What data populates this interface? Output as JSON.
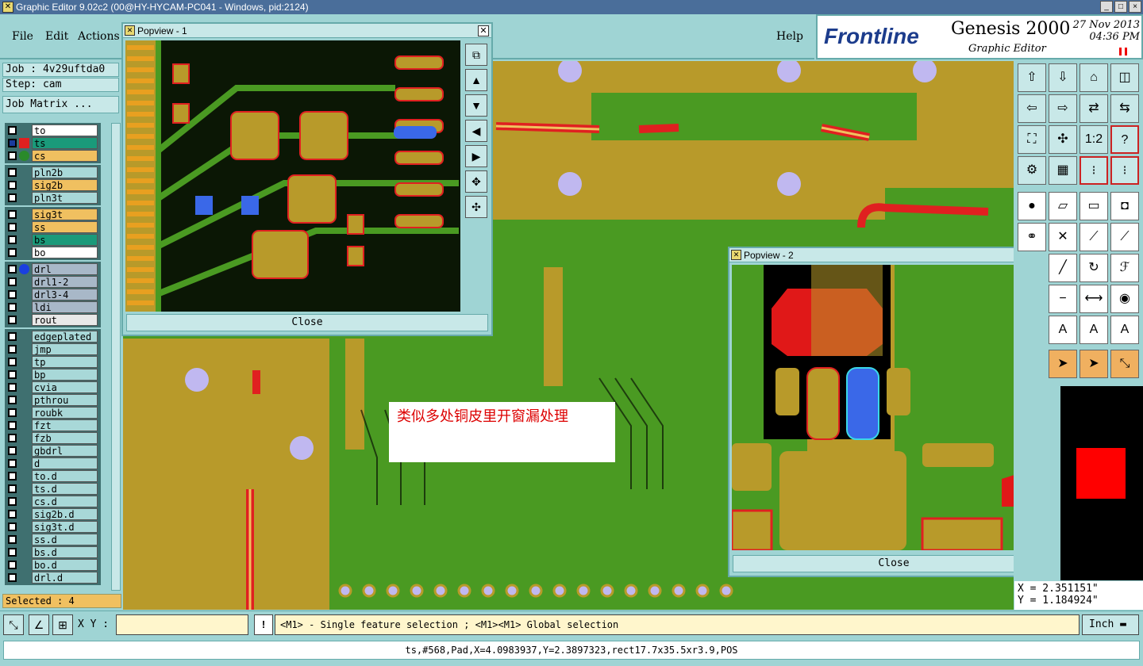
{
  "window": {
    "title": "Graphic Editor 9.02c2 (00@HY-HYCAM-PC041 - Windows, pid:2124)",
    "buttons": [
      "_",
      "□",
      "×"
    ]
  },
  "menu": {
    "file": "File",
    "edit": "Edit",
    "actions": "Actions",
    "help": "Help"
  },
  "logo": {
    "brand": "Frontline",
    "product": "Genesis 2000",
    "subtitle": "Graphic Editor",
    "date": "27 Nov 2013",
    "time": "04:36 PM"
  },
  "job": {
    "job_label": "Job : 4v29uftda0",
    "step_label": "Step: cam",
    "matrix_button": "Job Matrix ..."
  },
  "layers": [
    {
      "name": "to",
      "color": "#ffffff"
    },
    {
      "name": "ts",
      "color": "#1a9a7a",
      "active": true
    },
    {
      "name": "cs",
      "color": "#f0c060"
    },
    {
      "name": "pln2b",
      "color": "#a8d8d8"
    },
    {
      "name": "sig2b",
      "color": "#f0c060"
    },
    {
      "name": "pln3t",
      "color": "#a8d8d8"
    },
    {
      "name": "sig3t",
      "color": "#f0c060"
    },
    {
      "name": "ss",
      "color": "#f0c060"
    },
    {
      "name": "bs",
      "color": "#1a9a7a"
    },
    {
      "name": "bo",
      "color": "#ffffff"
    },
    {
      "name": "drl",
      "color": "#a8b8c8"
    },
    {
      "name": "drl1-2",
      "color": "#a8b8c8"
    },
    {
      "name": "drl3-4",
      "color": "#a8b8c8"
    },
    {
      "name": "ldi",
      "color": "#a8b8c8"
    },
    {
      "name": "rout",
      "color": "#e8e8e8"
    },
    {
      "name": "edgeplated",
      "color": "#a8d8d8"
    },
    {
      "name": "jmp",
      "color": "#a8d8d8"
    },
    {
      "name": "tp",
      "color": "#a8d8d8"
    },
    {
      "name": "bp",
      "color": "#a8d8d8"
    },
    {
      "name": "cvia",
      "color": "#a8d8d8"
    },
    {
      "name": "pthrou",
      "color": "#a8d8d8"
    },
    {
      "name": "roubk",
      "color": "#a8d8d8"
    },
    {
      "name": "fzt",
      "color": "#a8d8d8"
    },
    {
      "name": "fzb",
      "color": "#a8d8d8"
    },
    {
      "name": "gbdrl",
      "color": "#a8d8d8"
    },
    {
      "name": "d",
      "color": "#a8d8d8"
    },
    {
      "name": "to.d",
      "color": "#a8d8d8"
    },
    {
      "name": "ts.d",
      "color": "#a8d8d8"
    },
    {
      "name": "cs.d",
      "color": "#a8d8d8"
    },
    {
      "name": "sig2b.d",
      "color": "#a8d8d8"
    },
    {
      "name": "sig3t.d",
      "color": "#a8d8d8"
    },
    {
      "name": "ss.d",
      "color": "#a8d8d8"
    },
    {
      "name": "bs.d",
      "color": "#a8d8d8"
    },
    {
      "name": "bo.d",
      "color": "#a8d8d8"
    },
    {
      "name": "drl.d",
      "color": "#a8d8d8"
    }
  ],
  "selected": "Selected : 4",
  "popview1": {
    "title": "Popview - 1",
    "close": "Close"
  },
  "popview2": {
    "title": "Popview - 2",
    "close": "Close"
  },
  "annotation": "类似多处铜皮里开窗漏处理",
  "coords": {
    "x": "X = 2.351151\"",
    "y": "Y = 1.184924\""
  },
  "bottom": {
    "xy_label": "X Y :",
    "xy_value": "",
    "excl": "!",
    "message": "<M1> - Single feature selection ; <M1><M1> Global selection",
    "unit": "Inch"
  },
  "status": "ts,#568,Pad,X=4.0983937,Y=2.3897323,rect17.7x35.5xr3.9,POS"
}
